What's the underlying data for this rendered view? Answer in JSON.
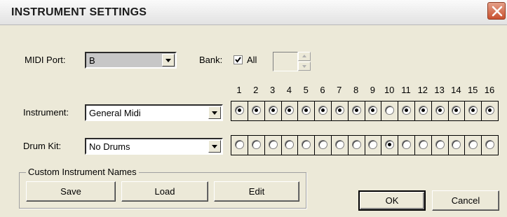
{
  "window": {
    "title": "INSTRUMENT SETTINGS",
    "close_icon": "close-icon"
  },
  "midi_port": {
    "label": "MIDI Port:",
    "value": "B"
  },
  "bank": {
    "label": "Bank:",
    "all_label": "All",
    "all_checked": true,
    "number_value": ""
  },
  "channels": [
    "1",
    "2",
    "3",
    "4",
    "5",
    "6",
    "7",
    "8",
    "9",
    "10",
    "11",
    "12",
    "13",
    "14",
    "15",
    "16"
  ],
  "instrument": {
    "label": "Instrument:",
    "value": "General Midi",
    "selected": [
      true,
      true,
      true,
      true,
      true,
      true,
      true,
      true,
      true,
      false,
      true,
      true,
      true,
      true,
      true,
      true
    ]
  },
  "drum_kit": {
    "label": "Drum Kit:",
    "value": "No Drums",
    "selected": [
      false,
      false,
      false,
      false,
      false,
      false,
      false,
      false,
      false,
      true,
      false,
      false,
      false,
      false,
      false,
      false
    ]
  },
  "custom_names": {
    "legend": "Custom Instrument Names",
    "save": "Save",
    "load": "Load",
    "edit": "Edit"
  },
  "dialog_buttons": {
    "ok": "OK",
    "cancel": "Cancel"
  },
  "colors": {
    "close_button": "#c9512f",
    "dialog_bg": "#ece9d8"
  }
}
